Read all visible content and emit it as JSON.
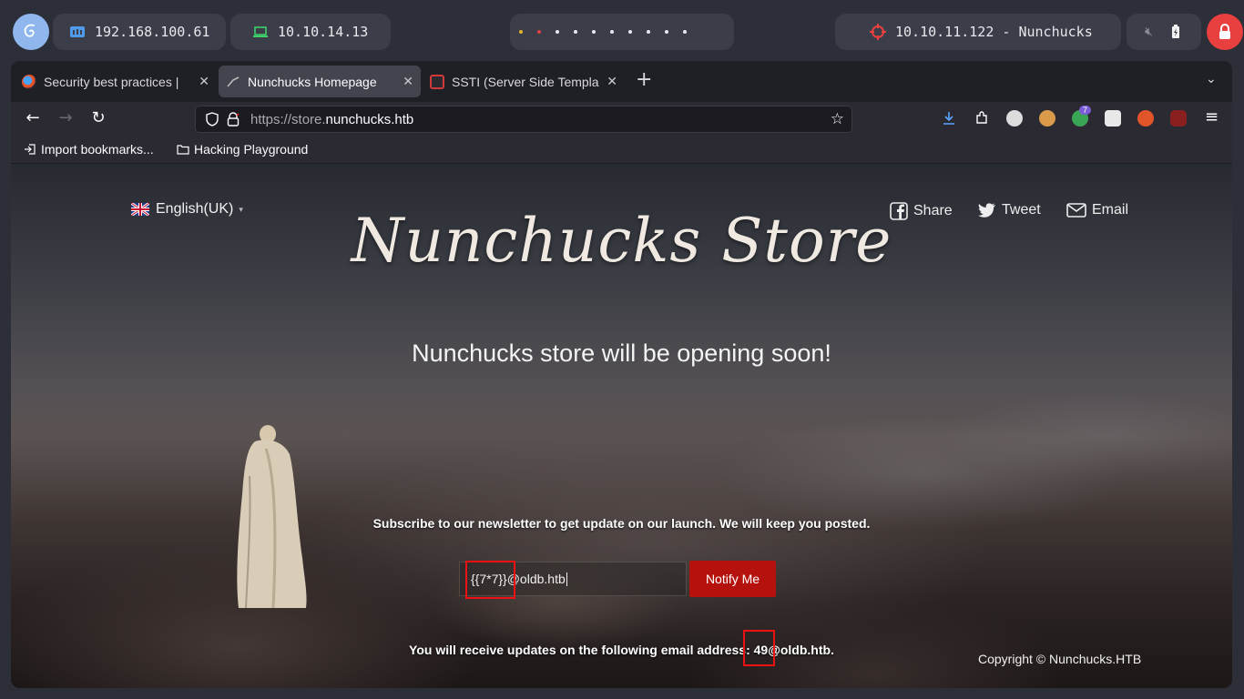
{
  "system_bar": {
    "ip_local": "192.168.100.61",
    "ip_vpn": "10.10.14.13",
    "target": "10.10.11.122 - Nunchucks",
    "workspace_dots": 10,
    "colors": {
      "accent_blue": "#8fb7ee",
      "lock_red": "#e83f3f"
    }
  },
  "browser": {
    "tabs": [
      {
        "title": "Security best practices |",
        "active": false,
        "favicon": "nodejs-favicon"
      },
      {
        "title": "Nunchucks Homepage",
        "active": true,
        "favicon": "nunchucks-favicon"
      },
      {
        "title": "SSTI (Server Side Templa",
        "active": false,
        "favicon": "hacktricks-favicon"
      }
    ],
    "url": {
      "scheme": "https://store.",
      "domain": "nunchucks.htb"
    },
    "extension_badge": "7",
    "bookmarks": [
      {
        "label": "Import bookmarks...",
        "icon": "import-icon"
      },
      {
        "label": "Hacking Playground",
        "icon": "folder-icon"
      }
    ]
  },
  "page": {
    "language": "English(UK)",
    "share": {
      "share_label": "Share",
      "tweet_label": "Tweet",
      "email_label": "Email"
    },
    "brand": "Nunchucks Store",
    "headline": "Nunchucks store will be opening soon!",
    "subscribe_text": "Subscribe to our newsletter to get update on our launch. We will keep you posted.",
    "email_input_value": "{{7*7}}@oldb.htb",
    "notify_button": "Notify Me",
    "result_text": "You will receive updates on the following email address: 49@oldb.htb.",
    "copyright": "Copyright © Nunchucks.HTB",
    "colors": {
      "button": "#b5120d",
      "highlight": "#ee1111"
    }
  }
}
